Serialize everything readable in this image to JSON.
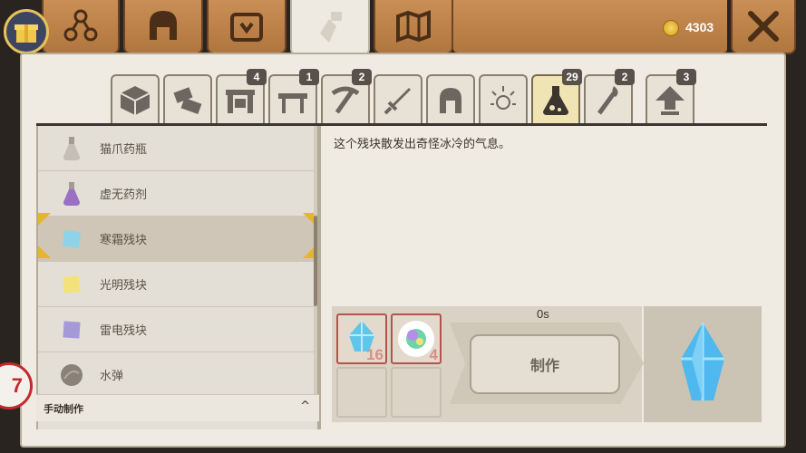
{
  "currency": {
    "amount": "4303",
    "icon": "coin-icon"
  },
  "top_tabs": [
    {
      "name": "gift",
      "icon": "gift-icon"
    },
    {
      "name": "skill-tree",
      "icon": "skill-tree-icon"
    },
    {
      "name": "equipment",
      "icon": "helmet-icon"
    },
    {
      "name": "inventory",
      "icon": "bag-icon"
    },
    {
      "name": "crafting",
      "icon": "crafting-icon",
      "active": true
    },
    {
      "name": "map",
      "icon": "map-icon"
    }
  ],
  "category_tabs": [
    {
      "icon": "block-icon",
      "badge": ""
    },
    {
      "icon": "materials-icon",
      "badge": ""
    },
    {
      "icon": "furniture-icon",
      "badge": "4"
    },
    {
      "icon": "table-icon",
      "badge": "1"
    },
    {
      "icon": "pickaxe-icon",
      "badge": "2"
    },
    {
      "icon": "sword-icon",
      "badge": ""
    },
    {
      "icon": "armor-icon",
      "badge": ""
    },
    {
      "icon": "magic-sparkle-icon",
      "badge": ""
    },
    {
      "icon": "potion-icon",
      "badge": "29",
      "active": true
    },
    {
      "icon": "torch-icon",
      "badge": "2"
    },
    {
      "icon": "upgrade-arrow-icon",
      "badge": "3"
    }
  ],
  "recipes": [
    {
      "label": "猫爪药瓶",
      "icon": "cat-paw-potion-icon"
    },
    {
      "label": "虚无药剂",
      "icon": "void-potion-icon"
    },
    {
      "label": "寒霜残块",
      "icon": "frost-fragment-icon",
      "selected": true
    },
    {
      "label": "光明残块",
      "icon": "light-fragment-icon"
    },
    {
      "label": "雷电残块",
      "icon": "thunder-fragment-icon"
    },
    {
      "label": "水弹",
      "icon": "water-bomb-icon"
    }
  ],
  "footer": {
    "label": "手动制作",
    "chevron": "^"
  },
  "description": "这个残块散发出奇怪冰冷的气息。",
  "craft": {
    "time": "0s",
    "button_label": "制作",
    "ingredients": [
      {
        "icon": "ice-crystal-icon",
        "count": "16"
      },
      {
        "icon": "rainbow-orb-icon",
        "count": "4"
      }
    ],
    "result_icon": "frost-crystal-icon"
  },
  "edge_badge": "7",
  "colors": {
    "accent": "#e6b52e",
    "parchment": "#efebe3",
    "wood": "#c98f55",
    "slot_border": "#b5544b"
  }
}
